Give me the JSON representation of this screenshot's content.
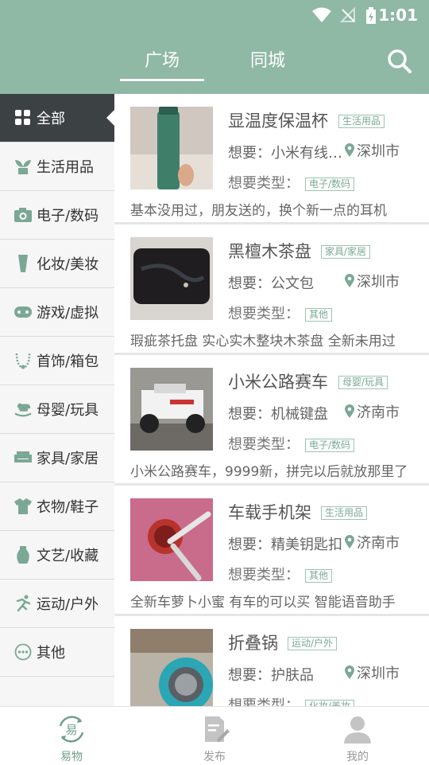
{
  "status_bar": {
    "time": "1:01"
  },
  "header": {
    "tabs": [
      {
        "label": "广场",
        "active": true
      },
      {
        "label": "同城",
        "active": false
      }
    ]
  },
  "sidebar": {
    "items": [
      {
        "label": "全部",
        "icon": "grid-icon",
        "active": true
      },
      {
        "label": "生活用品",
        "icon": "plant-icon"
      },
      {
        "label": "电子/数码",
        "icon": "camera-icon"
      },
      {
        "label": "化妆/美妆",
        "icon": "cup-icon"
      },
      {
        "label": "游戏/虚拟",
        "icon": "gamepad-icon"
      },
      {
        "label": "首饰/箱包",
        "icon": "necklace-icon"
      },
      {
        "label": "母婴/玩具",
        "icon": "rocking-horse-icon"
      },
      {
        "label": "家具/家居",
        "icon": "sofa-icon"
      },
      {
        "label": "衣物/鞋子",
        "icon": "shirt-icon"
      },
      {
        "label": "文艺/收藏",
        "icon": "vase-icon"
      },
      {
        "label": "运动/户外",
        "icon": "runner-icon"
      },
      {
        "label": "其他",
        "icon": "more-icon"
      }
    ]
  },
  "labels": {
    "want_prefix": "想要：",
    "want_type_prefix": "想要类型："
  },
  "items": [
    {
      "title": "显温度保温杯",
      "category": "生活用品",
      "want": "小米有线耳机",
      "city": "深圳市",
      "want_type": "电子/数码",
      "desc": "基本没用过，朋友送的，换个新一点的耳机"
    },
    {
      "title": "黑檀木茶盘",
      "category": "家具/家居",
      "want": "公文包",
      "city": "深圳市",
      "want_type": "其他",
      "desc": "瑕疵茶托盘 实心实木整块木茶盘 全新未用过"
    },
    {
      "title": "小米公路赛车",
      "category": "母婴/玩具",
      "want": "机械键盘",
      "city": "济南市",
      "want_type": "电子/数码",
      "desc": "小米公路赛车，9999新，拼完以后就放那里了"
    },
    {
      "title": "车载手机架",
      "category": "生活用品",
      "want": "精美钥匙扣",
      "city": "济南市",
      "want_type": "其他",
      "desc": "全新车萝卜小蜜 有车的可以买 智能语音助手"
    },
    {
      "title": "折叠锅",
      "category": "运动/户外",
      "want": "护肤品",
      "city": "深圳市",
      "want_type": "化妆/美妆",
      "desc": ""
    }
  ],
  "bottom_nav": [
    {
      "label": "易物",
      "icon": "swap-icon",
      "active": true
    },
    {
      "label": "发布",
      "icon": "edit-doc-icon"
    },
    {
      "label": "我的",
      "icon": "person-icon"
    }
  ],
  "colors": {
    "primary": "#8fb8a5",
    "sidebar_active": "#3c4144",
    "tag": "#7aa895"
  }
}
